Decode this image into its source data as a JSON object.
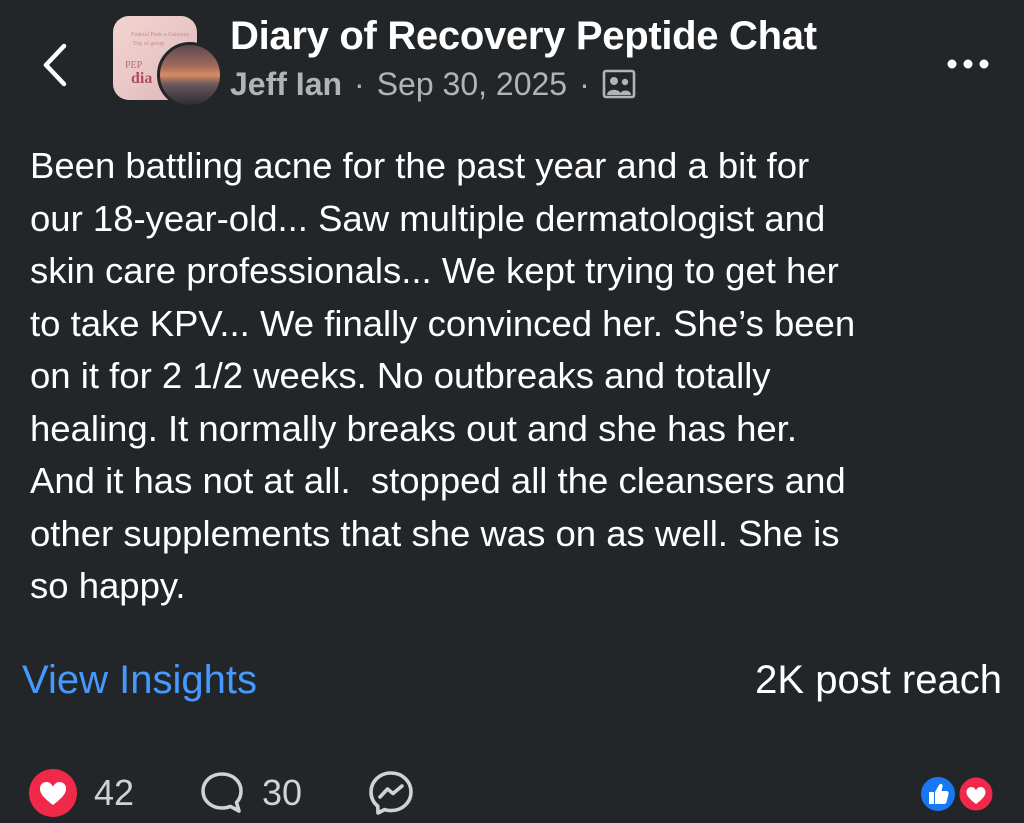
{
  "header": {
    "title": "Diary of Recovery Peptide Chat",
    "author": "Jeff Ian",
    "separator": "·",
    "date": "Sep 30, 2025",
    "privacy_icon": "group-members-icon",
    "group_thumb_text": {
      "line1": "Federal Parts a Gateway",
      "line2": "Top of group",
      "line3": "PEP",
      "line4": "dia"
    }
  },
  "post": {
    "body": "Been battling acne for the past year and a bit for\nour 18-year-old... Saw multiple dermatologist and\nskin care professionals... We kept trying to get her\nto take KPV... We finally convinced her. She’s been\non it for 2 1/2 weeks. No outbreaks and totally\nhealing. It normally breaks out and she has her.\nAnd it has not at all.  stopped all the cleansers and\nother supplements that she was on as well. She is\nso happy."
  },
  "insights": {
    "link_label": "View Insights",
    "reach": "2K post reach"
  },
  "actions": {
    "like_count": "42",
    "comment_count": "30"
  },
  "colors": {
    "background": "#232629",
    "link": "#4599ff",
    "like_red": "#f0284a",
    "like_blue": "#1877f2",
    "meta_gray": "#b0b3b8"
  }
}
